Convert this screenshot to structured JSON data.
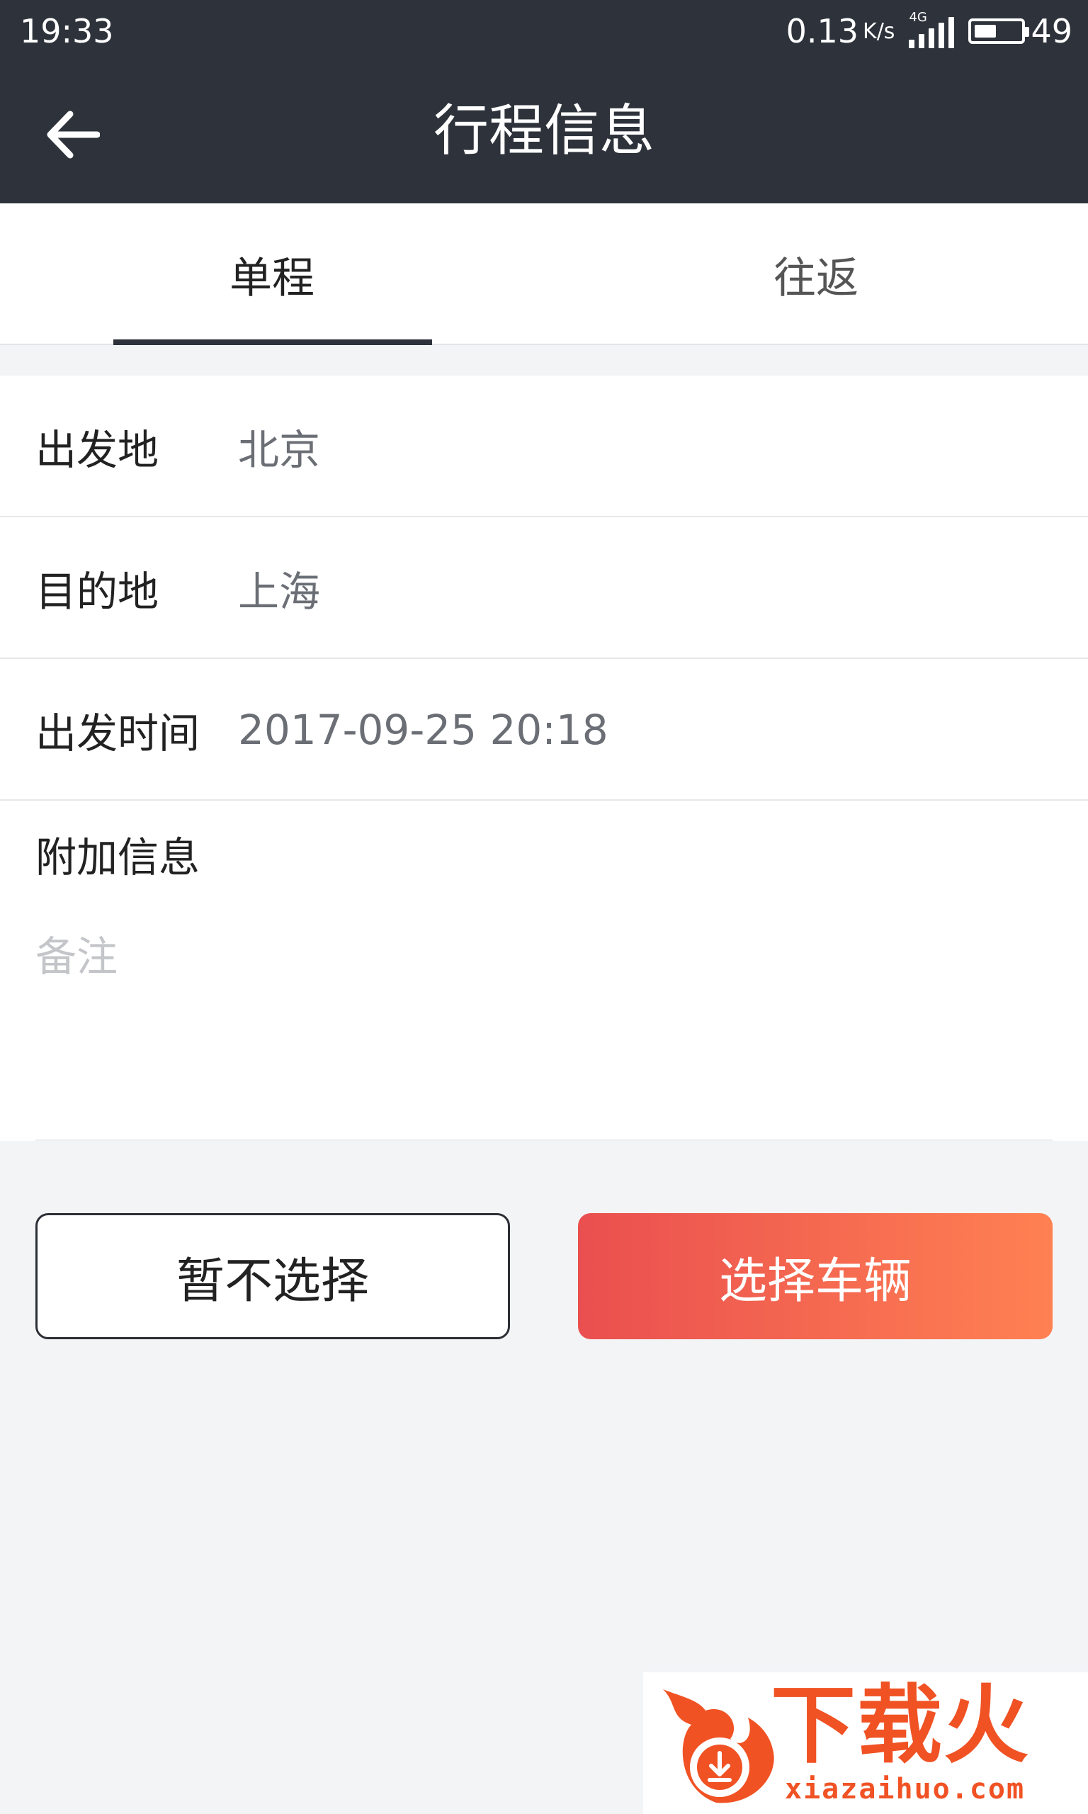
{
  "status_bar": {
    "time": "19:33",
    "speed": "0.13",
    "speed_unit": "K/s",
    "network": "4G",
    "battery": "49",
    "battery_level_percent": 49
  },
  "header": {
    "title": "行程信息",
    "back_icon": "arrow-left-icon"
  },
  "tabs": [
    {
      "label": "单程",
      "active": true
    },
    {
      "label": "往返",
      "active": false
    }
  ],
  "form": {
    "origin": {
      "label": "出发地",
      "value": "北京"
    },
    "destination": {
      "label": "目的地",
      "value": "上海"
    },
    "departure_time": {
      "label": "出发时间",
      "value": "2017-09-25 20:18"
    },
    "extra_label": "附加信息",
    "remark_placeholder": "备注"
  },
  "buttons": {
    "skip": "暂不选择",
    "choose_vehicle": "选择车辆"
  },
  "watermark": {
    "text": "下载火",
    "domain": "xiazaihuo.com"
  },
  "colors": {
    "header_bg": "#2e333b",
    "accent_gradient_start": "#ea4f4f",
    "accent_gradient_end": "#ff8152",
    "page_bg": "#f3f4f6"
  }
}
